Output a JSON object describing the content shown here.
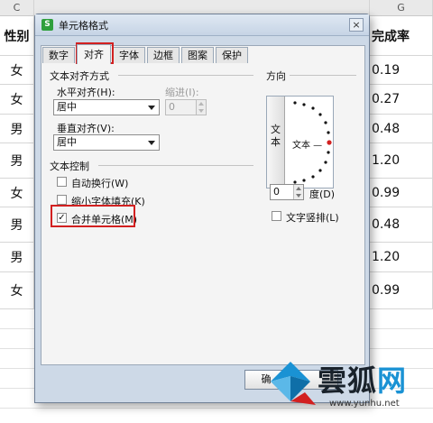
{
  "sheet": {
    "col_left": "C",
    "col_right": "G",
    "left_header": "性别",
    "right_header": "完成率",
    "genders": [
      "女",
      "女",
      "男",
      "男",
      "女",
      "男",
      "男",
      "女"
    ],
    "rates": [
      "0.19",
      "0.27",
      "0.48",
      "1.20",
      "0.99",
      "0.48",
      "1.20",
      "0.99"
    ]
  },
  "dialog": {
    "title": "单元格格式",
    "close_glyph": "×",
    "tabs": [
      "数字",
      "对齐",
      "字体",
      "边框",
      "图案",
      "保护"
    ],
    "active_tab": "对齐",
    "text_align_group": "文本对齐方式",
    "horizontal_label": "水平对齐(H):",
    "horizontal_value": "居中",
    "indent_label": "缩进(I):",
    "indent_value": "0",
    "vertical_label": "垂直对齐(V):",
    "vertical_value": "居中",
    "text_control_group": "文本控制",
    "checkboxes": [
      {
        "label": "自动换行(W)",
        "checked": false
      },
      {
        "label": "缩小字体填充(K)",
        "checked": false
      },
      {
        "label": "合并单元格(M)",
        "checked": true
      }
    ],
    "orientation_group": "方向",
    "vertical_text": [
      "文",
      "本"
    ],
    "orientation_sample": "文本 —",
    "degree_value": "0",
    "degree_label": "度(D)",
    "vertical_layout_label": "文字竖排(L)",
    "ok_label": "确",
    "check_mark": "✓"
  },
  "watermark": {
    "name_part1": "雲",
    "name_part2": "狐",
    "name_part3": "网",
    "url": "www.yunhu.net"
  },
  "colors": {
    "highlight": "#d22020",
    "dialog_bg": "#cdd9e7",
    "watermark_blue": "#1a92d4"
  }
}
